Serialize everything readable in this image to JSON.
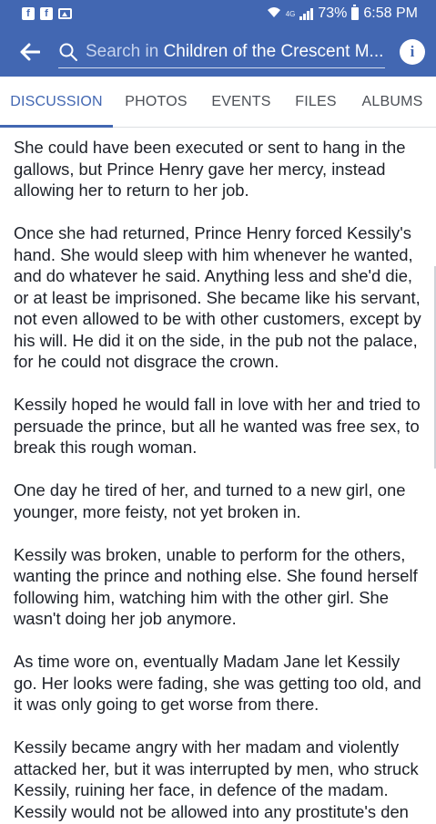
{
  "status_bar": {
    "network": "4G",
    "battery": "73%",
    "time": "6:58 PM"
  },
  "header": {
    "search_prefix": "Search in",
    "search_group": "Children of the Crescent M...",
    "info_label": "i",
    "accent_color": "#4267b2"
  },
  "tabs": [
    {
      "label": "DISCUSSION",
      "active": true
    },
    {
      "label": "PHOTOS",
      "active": false
    },
    {
      "label": "EVENTS",
      "active": false
    },
    {
      "label": "FILES",
      "active": false
    },
    {
      "label": "ALBUMS",
      "active": false
    }
  ],
  "post": {
    "paragraphs": [
      "She could have been executed or sent to hang in the gallows, but Prince Henry gave her mercy, instead allowing her to return to her job.",
      "Once she had returned, Prince Henry forced Kessily's hand. She would sleep with him whenever he wanted, and do whatever he said. Anything less and she'd die, or at least be imprisoned. She became like his servant, not even allowed to be with other customers, except by his will. He did it on the side, in the pub not the palace, for he could not disgrace the crown.",
      "Kessily hoped he would fall in love with her and tried to persuade the prince, but all he wanted was free sex, to break this rough woman.",
      "One day he tired of her, and turned to a new girl, one younger, more feisty, not yet broken in.",
      "Kessily was broken, unable to perform for the others, wanting the prince and nothing else. She found herself following him, watching him with the other girl. She wasn't doing her job anymore.",
      "As time wore on, eventually Madam Jane let Kessily go. Her looks were fading, she was getting too old, and it was only going to get worse from there.",
      "Kessily became angry with her madam and violently attacked her, but it was interrupted by men, who struck Kessily, ruining her face, in defence of the madam. Kessily would not be allowed into any prostitute's den"
    ]
  }
}
